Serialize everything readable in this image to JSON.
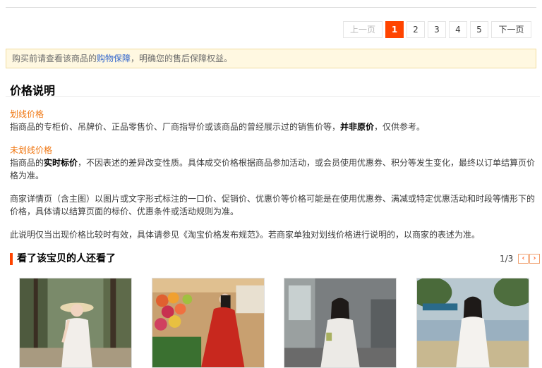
{
  "pagination": {
    "prev_label": "上一页",
    "pages": [
      "1",
      "2",
      "3",
      "4",
      "5"
    ],
    "current": "1",
    "next_label": "下一页"
  },
  "notice": {
    "prefix": "购买前请查看该商品的",
    "link": "购物保障",
    "suffix": "，明确您的售后保障权益。"
  },
  "price_section": {
    "title": "价格说明",
    "crossed_price": {
      "heading": "划线价格",
      "text_a": "指商品的专柜价、吊牌价、正品零售价、厂商指导价或该商品的曾经展示过的销售价等，",
      "bold": "并非原价",
      "text_b": "，仅供参考。"
    },
    "uncrossed_price": {
      "heading": "未划线价格",
      "text_a": "指商品的",
      "bold": "实时标价",
      "text_b": "，不因表述的差异改变性质。具体成交价格根据商品参加活动，或会员使用优惠券、积分等发生变化，最终以订单结算页价格为准。"
    },
    "detail_note": "商家详情页（含主图）以图片或文字形式标注的一口价、促销价、优惠价等价格可能是在使用优惠券、满减或特定优惠活动和时段等情形下的价格，具体请以结算页面的标价、优惠条件或活动规则为准。",
    "validity_note": "此说明仅当出现价格比较时有效，具体请参见《淘宝价格发布规范》。若商家单独对划线价格进行说明的，以商家的表述为准。"
  },
  "recommend": {
    "title": "看了该宝贝的人还看了",
    "page_indicator": "1/3",
    "prev_icon": "chevron-left-icon",
    "next_icon": "chevron-right-icon"
  },
  "colors": {
    "accent": "#ff4400",
    "heading_orange": "#f07814",
    "link_blue": "#3366cc",
    "notice_bg": "#fff8e1"
  }
}
